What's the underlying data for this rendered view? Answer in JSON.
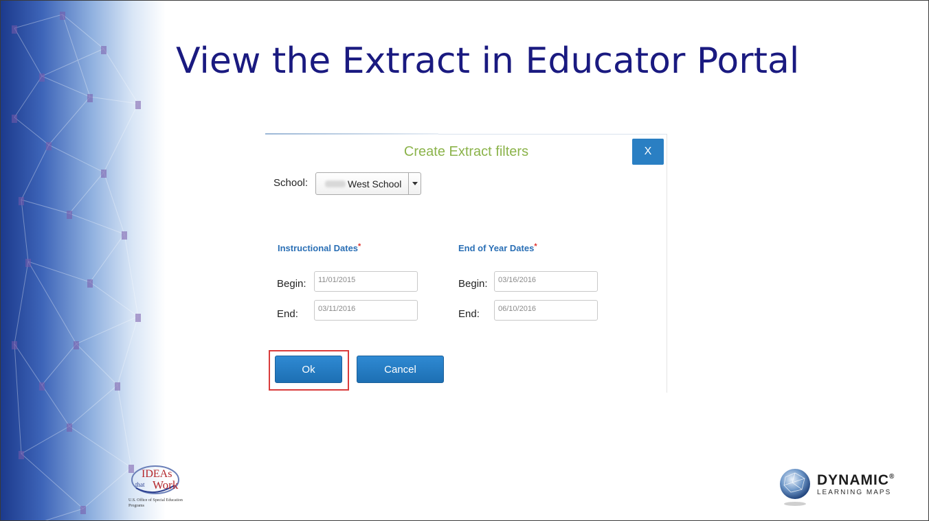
{
  "slide": {
    "title": "View the Extract in Educator Portal"
  },
  "dialog": {
    "title": "Create Extract filters",
    "close_label": "X",
    "school": {
      "label": "School:",
      "selected_value": "West School"
    },
    "instructional": {
      "heading": "Instructional Dates",
      "required_mark": "*",
      "begin_label": "Begin:",
      "begin_value": "11/01/2015",
      "end_label": "End:",
      "end_value": "03/11/2016"
    },
    "end_of_year": {
      "heading": "End of Year Dates",
      "required_mark": "*",
      "begin_label": "Begin:",
      "begin_value": "03/16/2016",
      "end_label": "End:",
      "end_value": "06/10/2016"
    },
    "ok_label": "Ok",
    "cancel_label": "Cancel"
  },
  "logos": {
    "ideas_line1": "IDEAs",
    "ideas_that": "that",
    "ideas_line2": "Work",
    "ideas_org": "U.S. Office of Special Education Programs",
    "dlm_name": "DYNAMIC",
    "dlm_reg": "®",
    "dlm_sub": "LEARNING MAPS"
  },
  "colors": {
    "title": "#1a1a80",
    "dialog_title": "#8bb34a",
    "button": "#2a7fc3",
    "section_heading": "#2a6fb5",
    "highlight": "#d93b3b"
  }
}
